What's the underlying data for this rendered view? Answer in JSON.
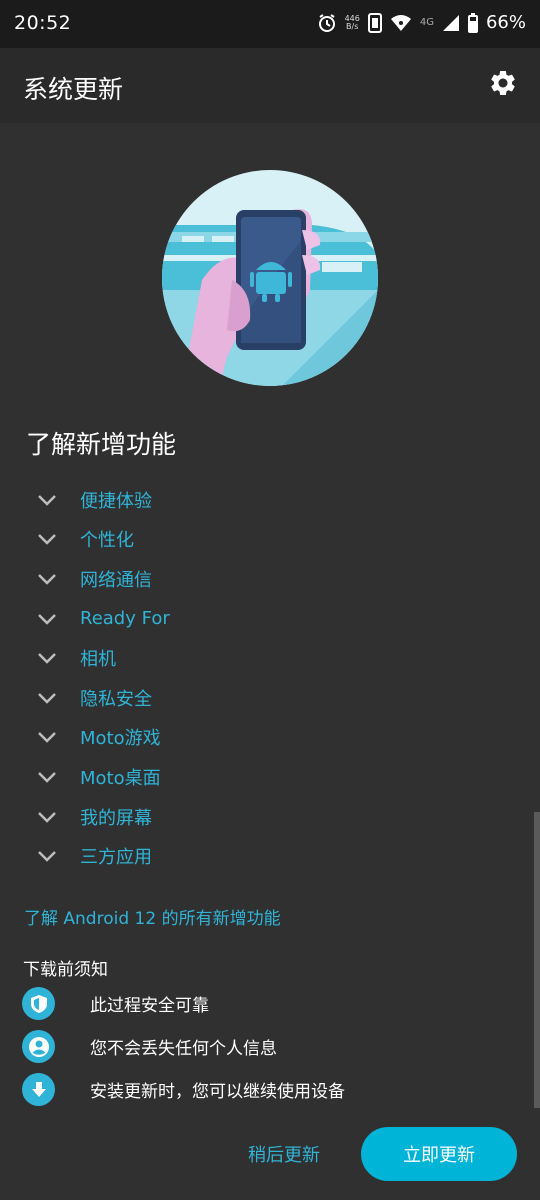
{
  "status_bar": {
    "time": "20:52",
    "net_speed_top": "446",
    "net_speed_unit": "B/s",
    "network_type": "4G",
    "battery": "66%"
  },
  "app_bar": {
    "title": "系统更新",
    "settings_icon": "gear-icon"
  },
  "section_title": "了解新增功能",
  "features": [
    {
      "label": "便捷体验"
    },
    {
      "label": "个性化"
    },
    {
      "label": "网络通信"
    },
    {
      "label": "Ready For"
    },
    {
      "label": "相机"
    },
    {
      "label": "隐私安全"
    },
    {
      "label": "Moto游戏"
    },
    {
      "label": "Moto桌面"
    },
    {
      "label": "我的屏幕"
    },
    {
      "label": "三方应用"
    }
  ],
  "all_features_link": "了解 Android 12 的所有新增功能",
  "notice": {
    "title": "下载前须知",
    "items": [
      {
        "icon": "shield-icon",
        "text": "此过程安全可靠"
      },
      {
        "icon": "person-icon",
        "text": "您不会丢失任何个人信息"
      },
      {
        "icon": "download-icon",
        "text": "安装更新时，您可以继续使用设备"
      }
    ]
  },
  "buttons": {
    "later": "稍后更新",
    "now": "立即更新"
  },
  "colors": {
    "accent": "#2fb4d8",
    "primary_button": "#00b4d8",
    "background": "#303030"
  }
}
